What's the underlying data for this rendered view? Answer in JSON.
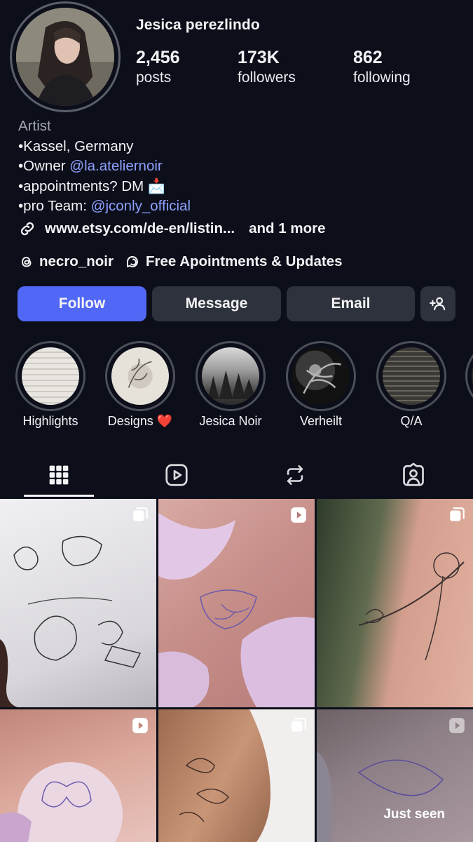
{
  "profile": {
    "username": "Jesica perezlindo",
    "stats": [
      {
        "value": "2,456",
        "label": "posts"
      },
      {
        "value": "173K",
        "label": "followers"
      },
      {
        "value": "862",
        "label": "following"
      }
    ],
    "bio": {
      "category": "Artist",
      "line1": "•Kassel, Germany",
      "line2_prefix": "•Owner ",
      "line2_mention": "@la.ateliernoir",
      "line3": "•appointments? DM 📩",
      "line4_prefix": "•pro Team: ",
      "line4_mention": "@jconly_official"
    },
    "link": {
      "url": "www.etsy.com/de-en/listin...",
      "more": "and 1 more"
    },
    "threads_handle": "necro_noir",
    "channel": "Free Apointments & Updates"
  },
  "actions": {
    "follow": "Follow",
    "message": "Message",
    "email": "Email"
  },
  "highlights": [
    {
      "label": "Highlights"
    },
    {
      "label": "Designs ❤️"
    },
    {
      "label": "Jesica Noir"
    },
    {
      "label": "Verheilt"
    },
    {
      "label": "Q/A"
    }
  ],
  "tabs": [
    "grid-icon",
    "reels-icon",
    "reposts-icon",
    "tagged-icon"
  ],
  "grid": {
    "overlay_text": "Just seen"
  },
  "colors": {
    "background": "#0c0f1a",
    "follow_button": "#5168f6",
    "secondary_button": "#2e323c",
    "mention": "#8ea0ff"
  }
}
